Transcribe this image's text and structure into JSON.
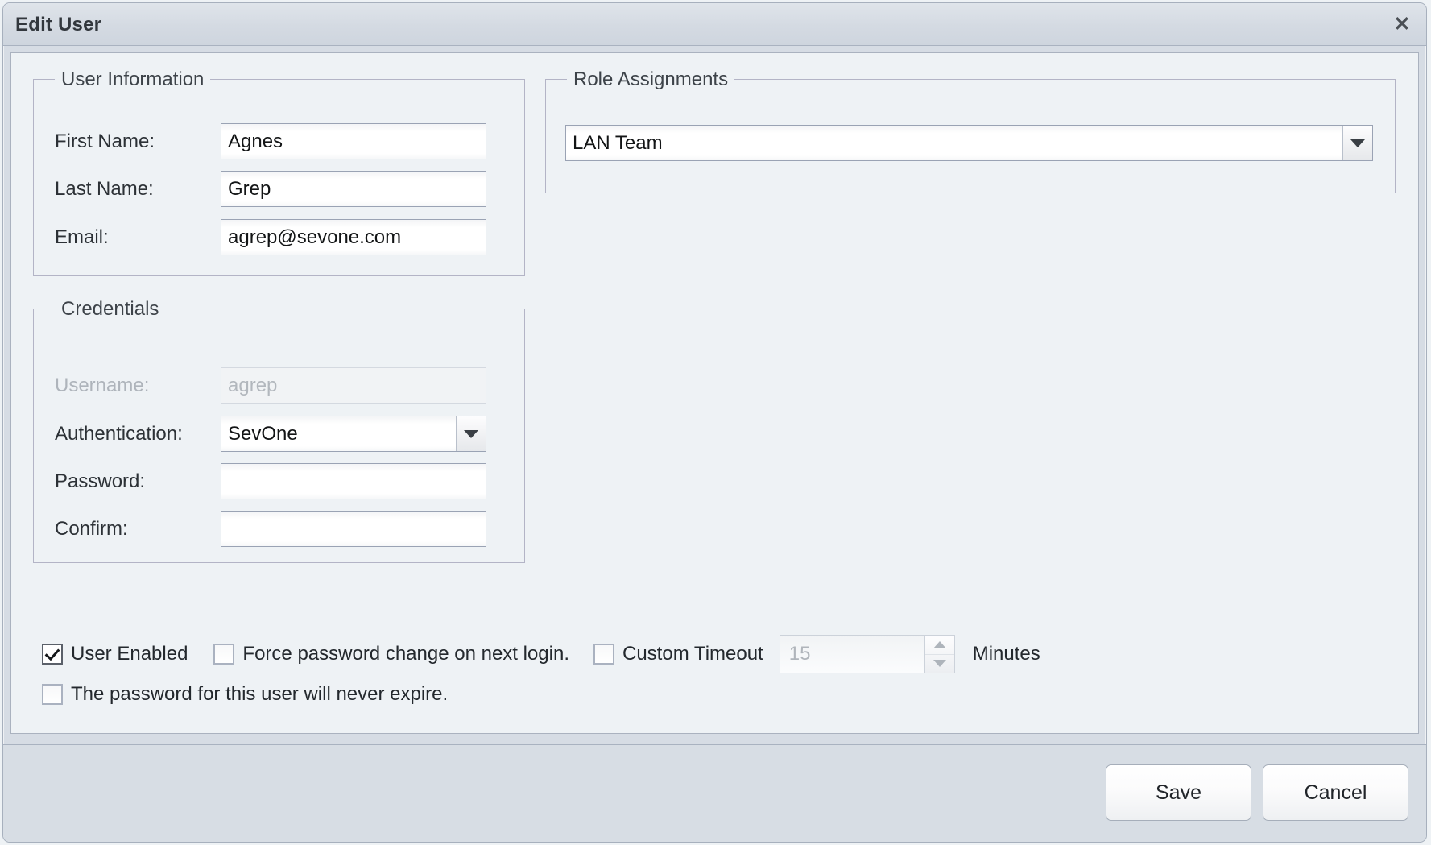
{
  "dialog": {
    "title": "Edit User",
    "close_icon": "close-icon"
  },
  "user_information": {
    "legend": "User Information",
    "fields": [
      {
        "label": "First Name:",
        "value": "Agnes",
        "disabled": false
      },
      {
        "label": "Last Name:",
        "value": "Grep",
        "disabled": false
      },
      {
        "label": "Email:",
        "value": "agrep@sevone.com",
        "disabled": false
      }
    ]
  },
  "credentials": {
    "legend": "Credentials",
    "username": {
      "label": "Username:",
      "value": "agrep",
      "disabled": true
    },
    "authentication": {
      "label": "Authentication:",
      "selected": "SevOne",
      "arrow_icon": "chevron-down-icon"
    },
    "password": {
      "label": "Password:",
      "value": ""
    },
    "confirm": {
      "label": "Confirm:",
      "value": ""
    }
  },
  "role_assignments": {
    "legend": "Role Assignments",
    "selected": "LAN Team",
    "arrow_icon": "chevron-down-icon"
  },
  "options": {
    "user_enabled": {
      "label": "User Enabled",
      "checked": true
    },
    "force_password": {
      "label": "Force password change on next login.",
      "checked": false
    },
    "custom_timeout": {
      "label": "Custom Timeout",
      "checked": false
    },
    "timeout_value": "15",
    "timeout_unit": "Minutes",
    "never_expire": {
      "label": "The password for this user will never expire.",
      "checked": false
    },
    "spinner_up_icon": "triangle-up-icon",
    "spinner_down_icon": "triangle-down-icon"
  },
  "footer": {
    "save_label": "Save",
    "cancel_label": "Cancel"
  },
  "colors": {
    "titlebar": "#d4dae2",
    "panel": "#eef2f5",
    "footer": "#d7dde4",
    "fieldset_border": "#b3b4c6",
    "input_border": "#9aa3b4",
    "text": "#23282d",
    "disabled_text": "#b0b5bb"
  }
}
